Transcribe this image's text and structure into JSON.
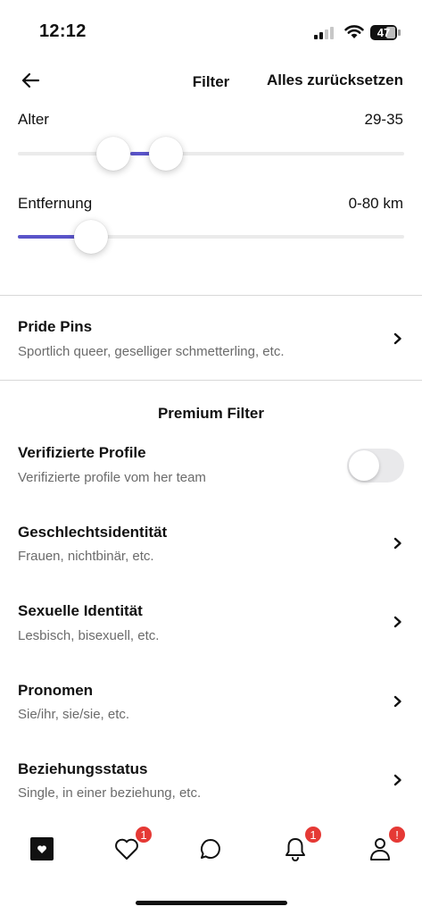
{
  "status": {
    "time": "12:12",
    "battery": "47"
  },
  "header": {
    "title": "Filter",
    "reset": "Alles zurücksetzen"
  },
  "age": {
    "label": "Alter",
    "value": "29-35"
  },
  "distance": {
    "label": "Entfernung",
    "value": "0-80 km"
  },
  "pride_pins": {
    "title": "Pride Pins",
    "subtitle": "Sportlich queer, geselliger schmetterling, etc."
  },
  "premium": {
    "title": "Premium Filter",
    "verified": {
      "title": "Verifizierte Profile",
      "subtitle": "Verifizierte profile vom her team"
    },
    "rows": [
      {
        "title": "Geschlechtsidentität",
        "subtitle": "Frauen, nichtbinär, etc."
      },
      {
        "title": "Sexuelle Identität",
        "subtitle": "Lesbisch, bisexuell, etc."
      },
      {
        "title": "Pronomen",
        "subtitle": "Sie/ihr, sie/sie, etc."
      },
      {
        "title": "Beziehungsstatus",
        "subtitle": "Single, in einer beziehung, etc."
      }
    ]
  },
  "tabbar": {
    "likes_badge": "1",
    "notifications_badge": "1",
    "profile_badge": "!"
  },
  "colors": {
    "accent": "#5a54c9",
    "badge": "#e53935"
  }
}
